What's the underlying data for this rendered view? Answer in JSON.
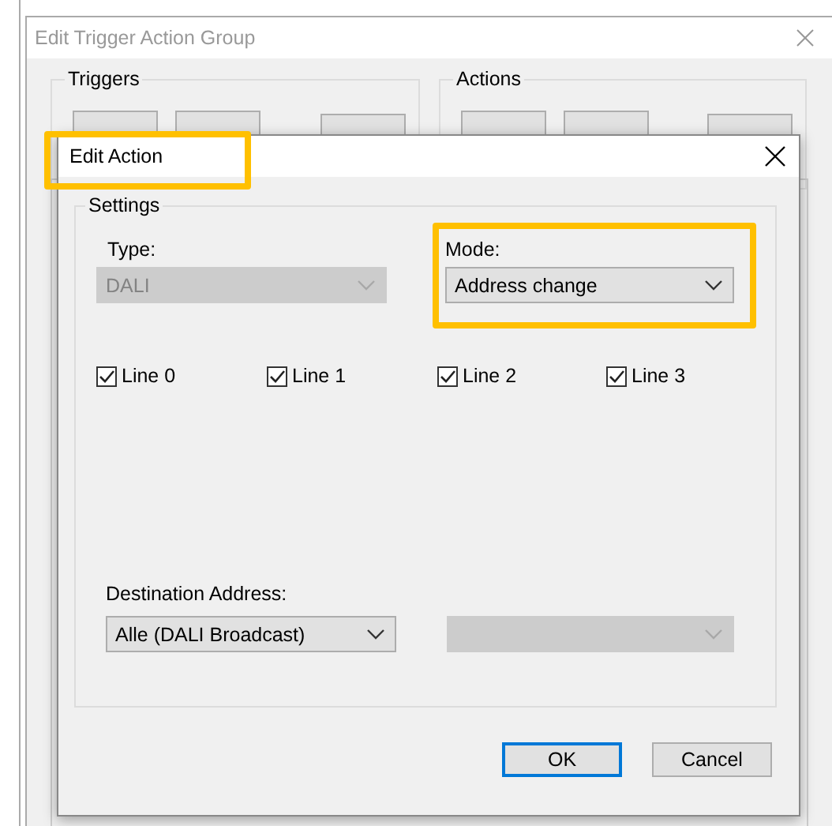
{
  "background_window": {
    "title": "Edit Trigger Action Group",
    "groups": [
      {
        "title": "Triggers"
      },
      {
        "title": "Actions"
      }
    ]
  },
  "dialog": {
    "title": "Edit Action",
    "title_highlighted": true,
    "settings": {
      "title": "Settings",
      "type": {
        "label": "Type:",
        "value": "DALI",
        "disabled": true
      },
      "mode": {
        "label": "Mode:",
        "value": "Address change",
        "disabled": false,
        "highlighted": true
      },
      "lines": [
        {
          "label": "Line 0",
          "checked": true
        },
        {
          "label": "Line 1",
          "checked": true
        },
        {
          "label": "Line 2",
          "checked": true
        },
        {
          "label": "Line 3",
          "checked": true
        }
      ],
      "destination": {
        "label": "Destination Address:",
        "value": "Alle (DALI Broadcast)",
        "disabled": false
      },
      "destination_detail": {
        "disabled": true
      }
    },
    "buttons": [
      {
        "label": "OK",
        "default": true
      },
      {
        "label": "Cancel",
        "default": false
      }
    ]
  }
}
